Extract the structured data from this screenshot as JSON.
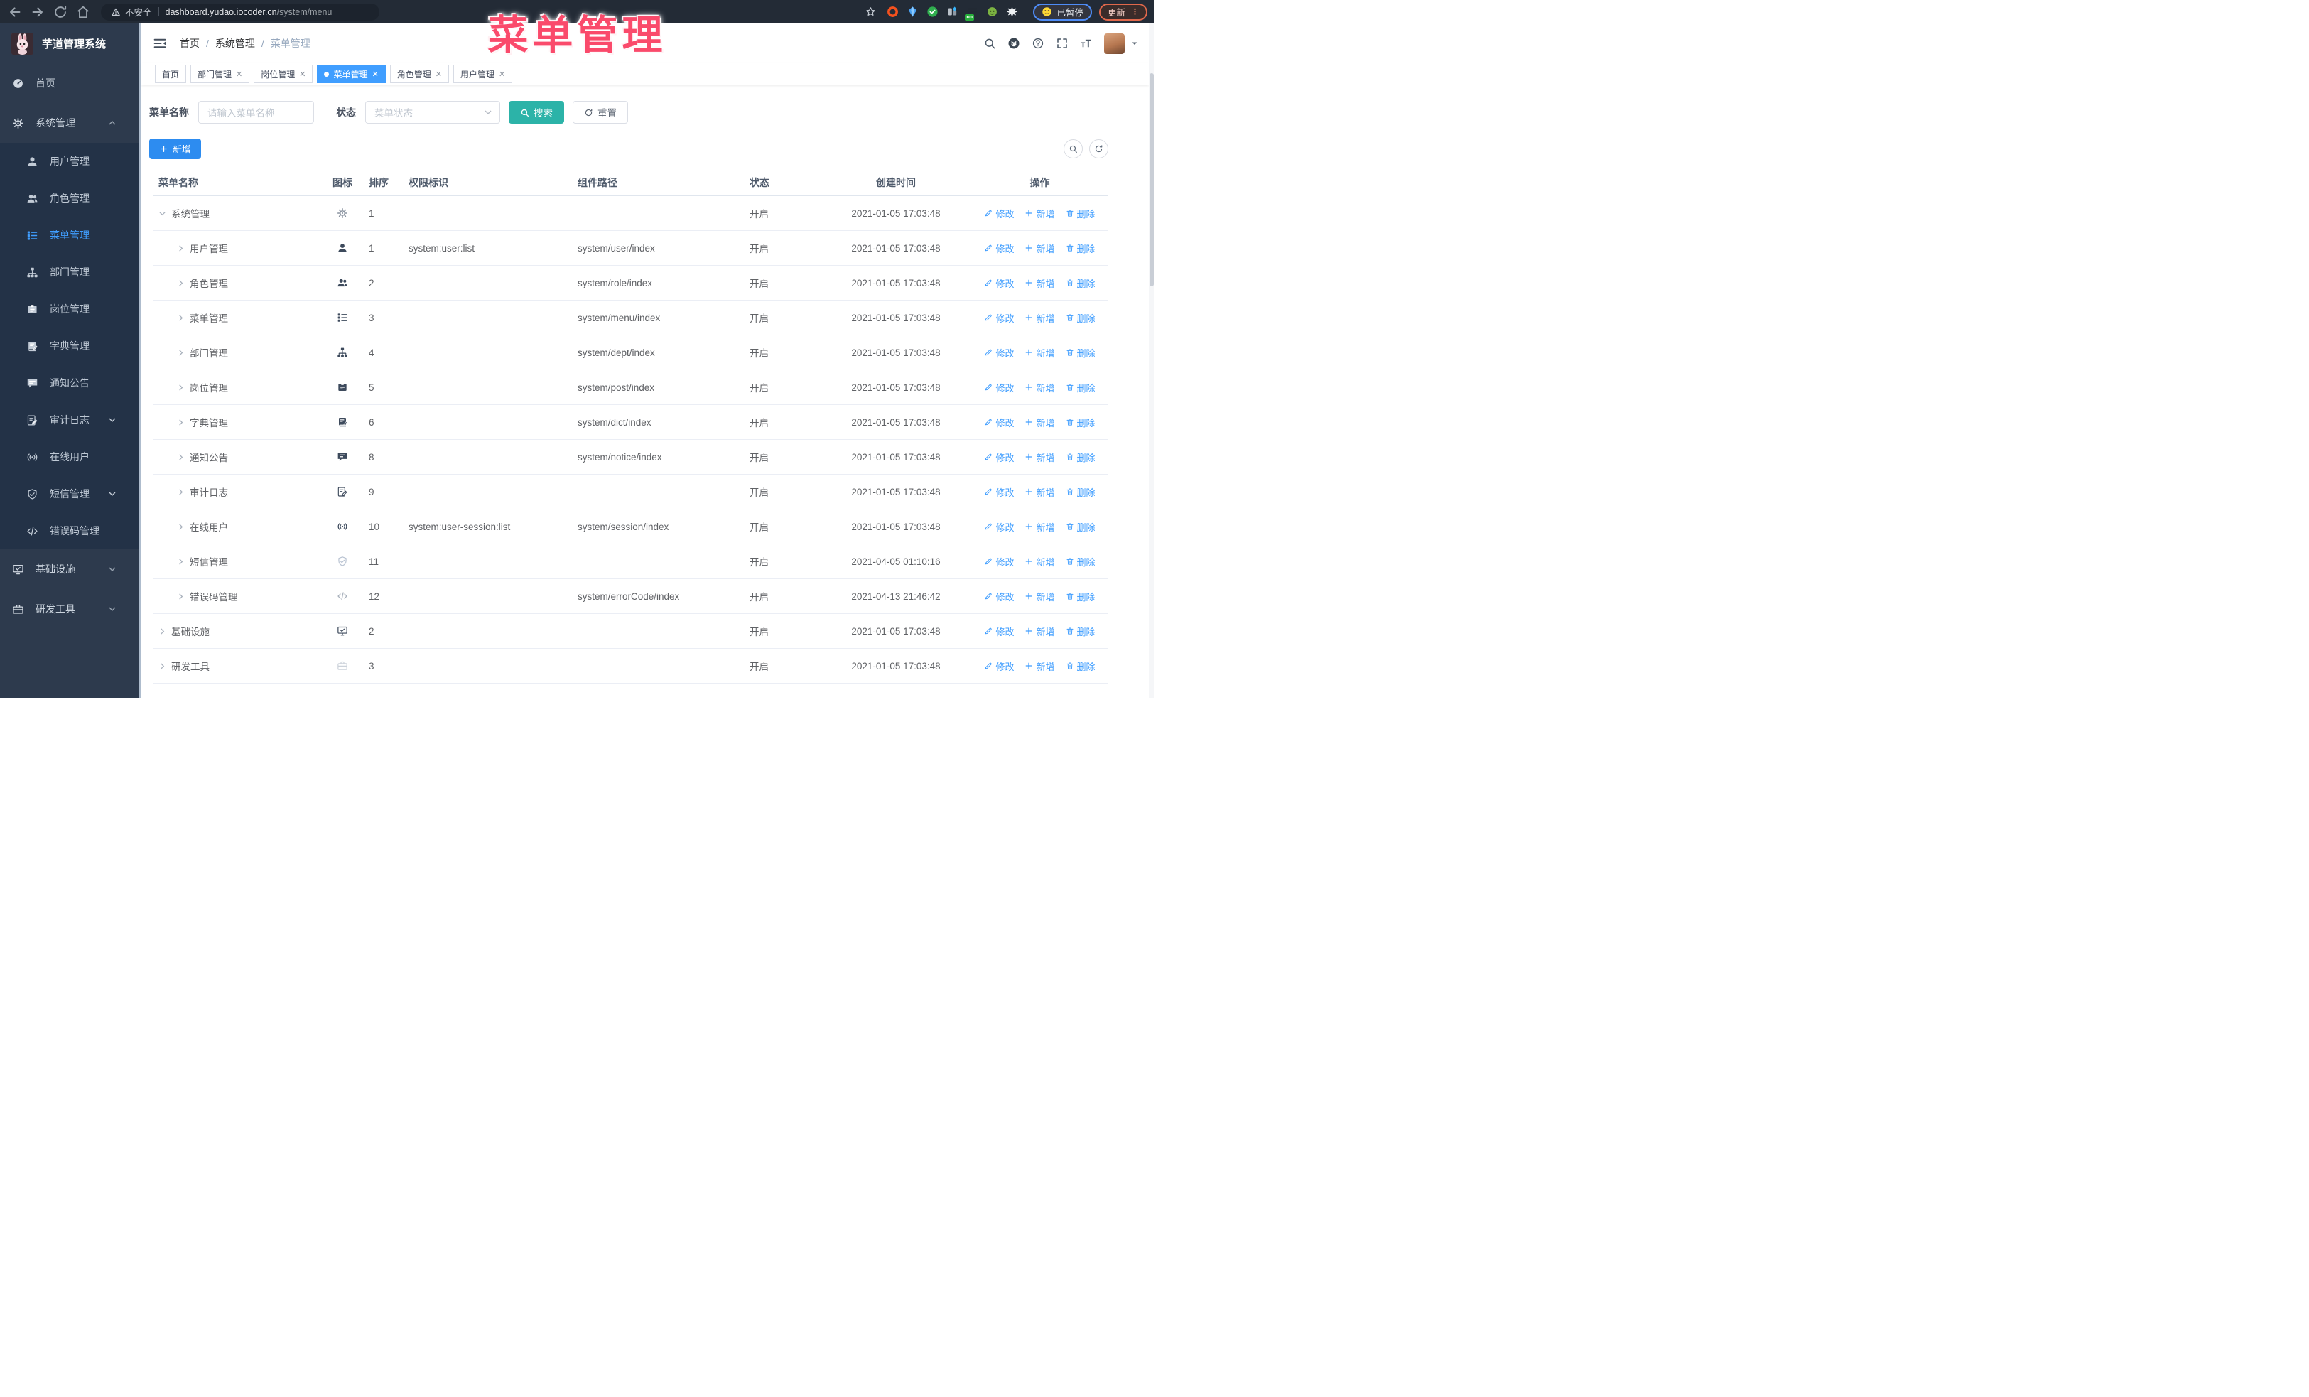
{
  "annotation": {
    "text": "菜单管理",
    "color": "#fa4a6b"
  },
  "browser": {
    "security_label": "不安全",
    "url_host": "dashboard.yudao.iocoder.cn",
    "url_path": "/system/menu",
    "paused_badge_label": "已暂停",
    "update_button_label": "更新",
    "extension_on_badge": "on",
    "nav_icons": [
      "back-icon",
      "forward-icon",
      "reload-icon",
      "home-icon",
      "warning-icon",
      "star-icon"
    ],
    "extension_icons": [
      "orange-ring-icon",
      "blue-gem-icon",
      "green-check-icon",
      "gray-bars-icon",
      "dark-list-on-icon",
      "green-monkey-icon",
      "white-puzzle-icon"
    ]
  },
  "sidebar": {
    "logo_title": "芋道管理系统",
    "logo_icon": "rabbit-avatar",
    "items": [
      {
        "label": "首页",
        "icon": "dashboard",
        "level": 0,
        "chevron": "",
        "active": false
      },
      {
        "label": "系统管理",
        "icon": "gear",
        "level": 0,
        "chevron": "up",
        "active": false
      },
      {
        "label": "用户管理",
        "icon": "user",
        "level": 1,
        "chevron": "",
        "active": false
      },
      {
        "label": "角色管理",
        "icon": "users",
        "level": 1,
        "chevron": "",
        "active": false
      },
      {
        "label": "菜单管理",
        "icon": "menu",
        "level": 1,
        "chevron": "",
        "active": true
      },
      {
        "label": "部门管理",
        "icon": "tree",
        "level": 1,
        "chevron": "",
        "active": false
      },
      {
        "label": "岗位管理",
        "icon": "post",
        "level": 1,
        "chevron": "",
        "active": false
      },
      {
        "label": "字典管理",
        "icon": "dict",
        "level": 1,
        "chevron": "",
        "active": false
      },
      {
        "label": "通知公告",
        "icon": "notice",
        "level": 1,
        "chevron": "",
        "active": false
      },
      {
        "label": "审计日志",
        "icon": "log",
        "level": 1,
        "chevron": "down",
        "active": false
      },
      {
        "label": "在线用户",
        "icon": "online",
        "level": 1,
        "chevron": "",
        "active": false
      },
      {
        "label": "短信管理",
        "icon": "sms",
        "level": 1,
        "chevron": "down",
        "active": false
      },
      {
        "label": "错误码管理",
        "icon": "code",
        "level": 1,
        "chevron": "",
        "active": false
      },
      {
        "label": "基础设施",
        "icon": "monitor",
        "level": 0,
        "chevron": "down",
        "active": false
      },
      {
        "label": "研发工具",
        "icon": "tool",
        "level": 0,
        "chevron": "down",
        "active": false
      }
    ]
  },
  "header": {
    "breadcrumb": [
      "首页",
      "系统管理",
      "菜单管理"
    ],
    "icons": [
      "hamburger-icon",
      "search-icon",
      "github-icon",
      "question-icon",
      "fullscreen-icon",
      "font-size-icon",
      "avatar",
      "caret-down-icon"
    ]
  },
  "tabs": [
    {
      "label": "首页",
      "closable": false,
      "active": false
    },
    {
      "label": "部门管理",
      "closable": true,
      "active": false
    },
    {
      "label": "岗位管理",
      "closable": true,
      "active": false
    },
    {
      "label": "菜单管理",
      "closable": true,
      "active": true
    },
    {
      "label": "角色管理",
      "closable": true,
      "active": false
    },
    {
      "label": "用户管理",
      "closable": true,
      "active": false
    }
  ],
  "filters": {
    "name_label": "菜单名称",
    "name_placeholder": "请输入菜单名称",
    "status_label": "状态",
    "status_placeholder": "菜单状态",
    "search_label": "搜索",
    "reset_label": "重置"
  },
  "toolbar": {
    "add_label": "新增"
  },
  "table": {
    "columns": [
      "菜单名称",
      "图标",
      "排序",
      "权限标识",
      "组件路径",
      "状态",
      "创建时间",
      "操作"
    ],
    "action_labels": {
      "edit": "修改",
      "add": "新增",
      "delete": "删除"
    },
    "rows": [
      {
        "name": "系统管理",
        "icon": "gear",
        "icon_color": "#8a93a0",
        "level": 0,
        "expanded": true,
        "order": "1",
        "perm": "",
        "path": "",
        "status": "开启",
        "created": "2021-01-05 17:03:48"
      },
      {
        "name": "用户管理",
        "icon": "user",
        "icon_color": "#3d4a5c",
        "level": 1,
        "expanded": false,
        "order": "1",
        "perm": "system:user:list",
        "path": "system/user/index",
        "status": "开启",
        "created": "2021-01-05 17:03:48"
      },
      {
        "name": "角色管理",
        "icon": "users",
        "icon_color": "#3d4a5c",
        "level": 1,
        "expanded": false,
        "order": "2",
        "perm": "",
        "path": "system/role/index",
        "status": "开启",
        "created": "2021-01-05 17:03:48"
      },
      {
        "name": "菜单管理",
        "icon": "menu",
        "icon_color": "#3d4a5c",
        "level": 1,
        "expanded": false,
        "order": "3",
        "perm": "",
        "path": "system/menu/index",
        "status": "开启",
        "created": "2021-01-05 17:03:48"
      },
      {
        "name": "部门管理",
        "icon": "tree",
        "icon_color": "#3d4a5c",
        "level": 1,
        "expanded": false,
        "order": "4",
        "perm": "",
        "path": "system/dept/index",
        "status": "开启",
        "created": "2021-01-05 17:03:48"
      },
      {
        "name": "岗位管理",
        "icon": "post",
        "icon_color": "#3d4a5c",
        "level": 1,
        "expanded": false,
        "order": "5",
        "perm": "",
        "path": "system/post/index",
        "status": "开启",
        "created": "2021-01-05 17:03:48"
      },
      {
        "name": "字典管理",
        "icon": "dict",
        "icon_color": "#3d4a5c",
        "level": 1,
        "expanded": false,
        "order": "6",
        "perm": "",
        "path": "system/dict/index",
        "status": "开启",
        "created": "2021-01-05 17:03:48"
      },
      {
        "name": "通知公告",
        "icon": "notice",
        "icon_color": "#3d4a5c",
        "level": 1,
        "expanded": false,
        "order": "8",
        "perm": "",
        "path": "system/notice/index",
        "status": "开启",
        "created": "2021-01-05 17:03:48"
      },
      {
        "name": "审计日志",
        "icon": "log",
        "icon_color": "#3d4a5c",
        "level": 1,
        "expanded": false,
        "order": "9",
        "perm": "",
        "path": "",
        "status": "开启",
        "created": "2021-01-05 17:03:48"
      },
      {
        "name": "在线用户",
        "icon": "online",
        "icon_color": "#3d4a5c",
        "level": 1,
        "expanded": false,
        "order": "10",
        "perm": "system:user-session:list",
        "path": "system/session/index",
        "status": "开启",
        "created": "2021-01-05 17:03:48"
      },
      {
        "name": "短信管理",
        "icon": "sms",
        "icon_color": "#b9c3d2",
        "level": 1,
        "expanded": false,
        "order": "11",
        "perm": "",
        "path": "",
        "status": "开启",
        "created": "2021-04-05 01:10:16"
      },
      {
        "name": "错误码管理",
        "icon": "code",
        "icon_color": "#aab2bd",
        "level": 1,
        "expanded": false,
        "order": "12",
        "perm": "",
        "path": "system/errorCode/index",
        "status": "开启",
        "created": "2021-04-13 21:46:42"
      },
      {
        "name": "基础设施",
        "icon": "monitor",
        "icon_color": "#3d4a5c",
        "level": 0,
        "expanded": false,
        "order": "2",
        "perm": "",
        "path": "",
        "status": "开启",
        "created": "2021-01-05 17:03:48"
      },
      {
        "name": "研发工具",
        "icon": "tool",
        "icon_color": "#ccd2da",
        "level": 0,
        "expanded": false,
        "order": "3",
        "perm": "",
        "path": "",
        "status": "开启",
        "created": "2021-01-05 17:03:48"
      }
    ]
  },
  "colors": {
    "primary": "#409eff",
    "add_button_blue": "#2d8cf0",
    "search_teal": "#2cb3a8",
    "annotation_pink": "#fa4a6b",
    "sidebar_bg": "#2d3a4d",
    "submenu_bg": "#233247"
  }
}
